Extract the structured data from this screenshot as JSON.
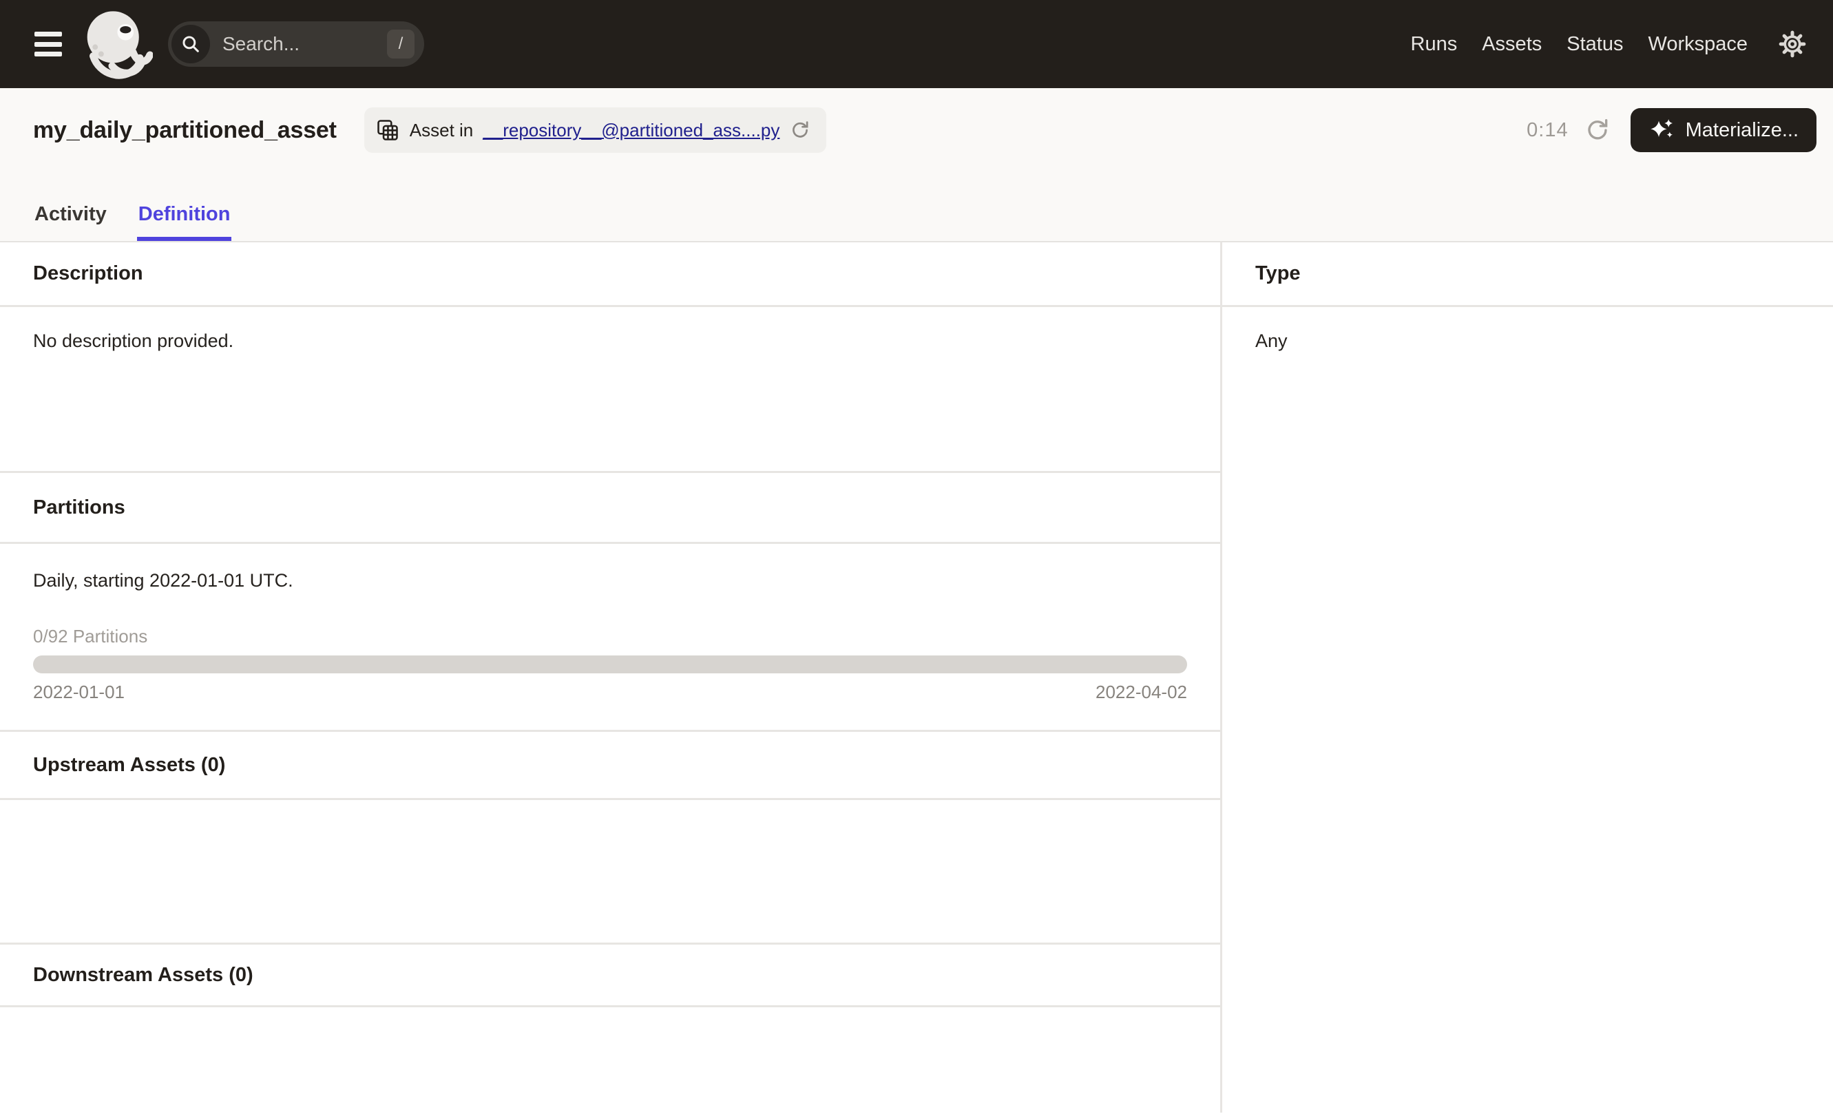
{
  "topbar": {
    "search": {
      "placeholder": "Search...",
      "shortcut": "/",
      "value": ""
    },
    "nav": [
      {
        "label": "Runs"
      },
      {
        "label": "Assets"
      },
      {
        "label": "Status"
      },
      {
        "label": "Workspace"
      }
    ]
  },
  "header": {
    "title": "my_daily_partitioned_asset",
    "asset_tag": {
      "prefix": "Asset in",
      "link": "__repository__@partitioned_ass....py"
    },
    "timer": "0:14",
    "materialize_label": "Materialize..."
  },
  "tabs": [
    {
      "label": "Activity",
      "active": false
    },
    {
      "label": "Definition",
      "active": true
    }
  ],
  "sections": {
    "description": {
      "title": "Description",
      "body": "No description provided."
    },
    "partitions": {
      "title": "Partitions",
      "summary": "Daily, starting 2022-01-01 UTC.",
      "progress_label": "0/92 Partitions",
      "progress_percent": 0,
      "range_start": "2022-01-01",
      "range_end": "2022-04-02"
    },
    "upstream": {
      "title": "Upstream Assets (0)"
    },
    "downstream": {
      "title": "Downstream Assets (0)"
    },
    "type": {
      "title": "Type",
      "value": "Any"
    }
  },
  "colors": {
    "topbar_bg": "#231f1b",
    "header_bg": "#faf9f7",
    "accent": "#4f43dd",
    "link": "#20208d",
    "divider": "#e7e5e2",
    "progress_track": "#d7d4d0",
    "muted_text": "#a09c97"
  }
}
